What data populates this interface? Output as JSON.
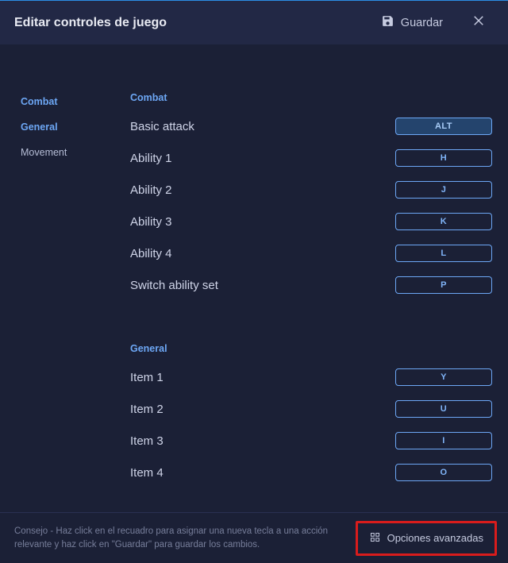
{
  "header": {
    "title": "Editar controles de juego",
    "save_label": "Guardar"
  },
  "sidebar": {
    "items": [
      {
        "label": "Combat",
        "plain": false
      },
      {
        "label": "General",
        "plain": false
      },
      {
        "label": "Movement",
        "plain": true
      }
    ]
  },
  "sections": {
    "combat": {
      "title": "Combat",
      "rows": [
        {
          "label": "Basic attack",
          "key": "ALT",
          "active": true
        },
        {
          "label": "Ability 1",
          "key": "H",
          "active": false
        },
        {
          "label": "Ability 2",
          "key": "J",
          "active": false
        },
        {
          "label": "Ability 3",
          "key": "K",
          "active": false
        },
        {
          "label": "Ability 4",
          "key": "L",
          "active": false
        },
        {
          "label": "Switch ability set",
          "key": "P",
          "active": false
        }
      ]
    },
    "general": {
      "title": "General",
      "rows": [
        {
          "label": "Item 1",
          "key": "Y",
          "active": false
        },
        {
          "label": "Item 2",
          "key": "U",
          "active": false
        },
        {
          "label": "Item 3",
          "key": "I",
          "active": false
        },
        {
          "label": "Item 4",
          "key": "O",
          "active": false
        }
      ]
    }
  },
  "footer": {
    "tip": "Consejo - Haz click en el recuadro para asignar una nueva tecla a una acción relevante y haz click en \"Guardar\" para guardar los cambios.",
    "advanced_label": "Opciones avanzadas"
  }
}
